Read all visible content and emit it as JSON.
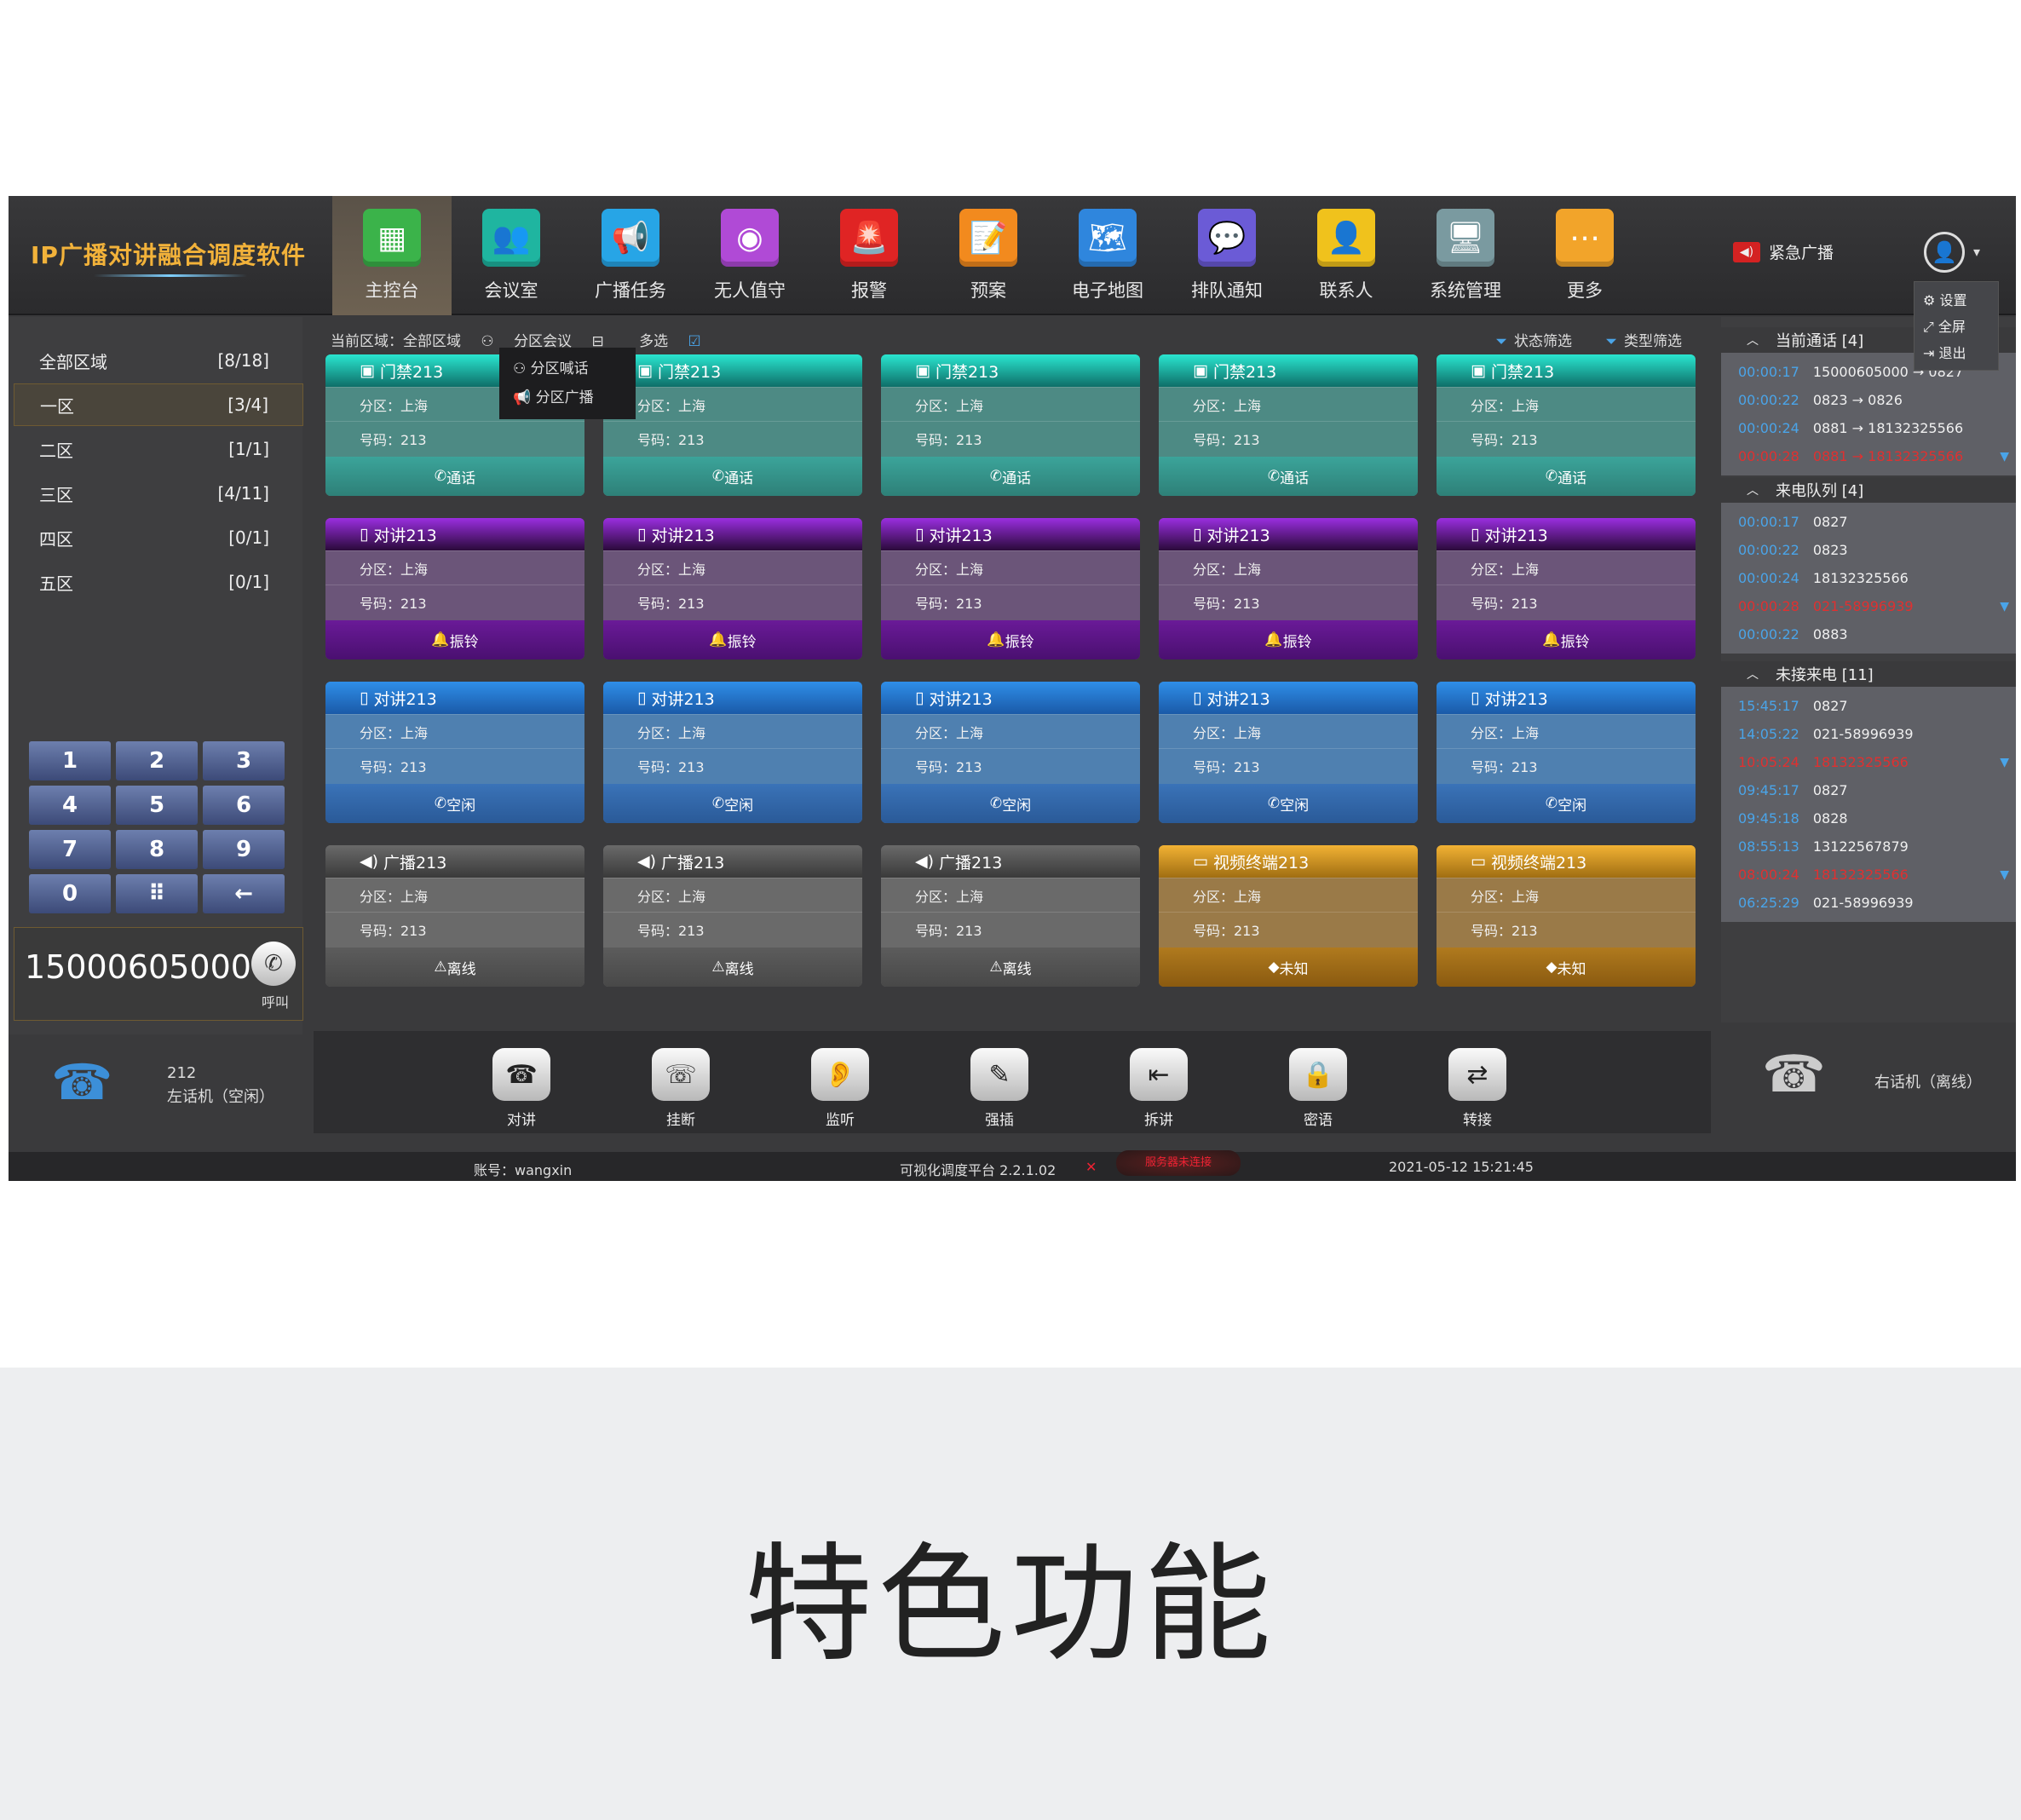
{
  "app": {
    "logo": "IP广播对讲融合调度软件",
    "emergency": "紧急广播",
    "user_menu": [
      "设置",
      "全屏",
      "退出"
    ]
  },
  "nav": [
    {
      "label": "主控台",
      "icon": "dashboard-icon",
      "color": "#3bb34a",
      "glyph": "▦",
      "active": true
    },
    {
      "label": "会议室",
      "icon": "meeting-icon",
      "color": "#1fb5a0",
      "glyph": "👥"
    },
    {
      "label": "广播任务",
      "icon": "broadcast-icon",
      "color": "#27a5e6",
      "glyph": "📢"
    },
    {
      "label": "无人值守",
      "icon": "unattended-icon",
      "color": "#b04ad6",
      "glyph": "◉"
    },
    {
      "label": "报警",
      "icon": "alarm-icon",
      "color": "#e02424",
      "glyph": "🚨"
    },
    {
      "label": "预案",
      "icon": "plan-icon",
      "color": "#f28a1e",
      "glyph": "📝"
    },
    {
      "label": "电子地图",
      "icon": "map-icon",
      "color": "#2f86dd",
      "glyph": "🗺"
    },
    {
      "label": "排队通知",
      "icon": "queue-icon",
      "color": "#6b5bd6",
      "glyph": "💬"
    },
    {
      "label": "联系人",
      "icon": "contacts-icon",
      "color": "#f0c21c",
      "glyph": "👤"
    },
    {
      "label": "系统管理",
      "icon": "system-icon",
      "color": "#7a9aa0",
      "glyph": "🖥"
    },
    {
      "label": "更多",
      "icon": "more-icon",
      "color": "#f2a42a",
      "glyph": "⋯"
    }
  ],
  "zones": [
    {
      "name": "全部区域",
      "count": "[8/18]"
    },
    {
      "name": "一区",
      "count": "[3/4]",
      "selected": true
    },
    {
      "name": "二区",
      "count": "[1/1]"
    },
    {
      "name": "三区",
      "count": "[4/11]"
    },
    {
      "name": "四区",
      "count": "[0/1]"
    },
    {
      "name": "五区",
      "count": "[0/1]"
    }
  ],
  "keypad": [
    "1",
    "2",
    "3",
    "4",
    "5",
    "6",
    "7",
    "8",
    "9",
    "0",
    "⠿",
    "←"
  ],
  "dial": {
    "number": "15000605000",
    "call_label": "呼叫"
  },
  "left_phone": {
    "ext": "212",
    "status": "左话机（空闲）"
  },
  "right_phone": {
    "status": "右话机（离线）"
  },
  "toolbar": {
    "current_zone": "当前区域：全部区域",
    "zone_meeting": "分区会议",
    "multi_select": "多选",
    "state_filter": "状态筛选",
    "type_filter": "类型筛选",
    "dropdown": [
      "分区喊话",
      "分区广播"
    ]
  },
  "cards": [
    [
      {
        "type": "teal",
        "title": "门禁213",
        "zone": "分区：上海",
        "num": "号码：213",
        "action": "通话"
      },
      {
        "type": "teal",
        "title": "门禁213",
        "zone": "分区：上海",
        "num": "号码：213",
        "action": "通话"
      },
      {
        "type": "teal",
        "title": "门禁213",
        "zone": "分区：上海",
        "num": "号码：213",
        "action": "通话"
      },
      {
        "type": "teal",
        "title": "门禁213",
        "zone": "分区：上海",
        "num": "号码：213",
        "action": "通话"
      },
      {
        "type": "teal",
        "title": "门禁213",
        "zone": "分区：上海",
        "num": "号码：213",
        "action": "通话"
      }
    ],
    [
      {
        "type": "purple",
        "title": "对讲213",
        "zone": "分区：上海",
        "num": "号码：213",
        "action": "振铃"
      },
      {
        "type": "purple",
        "title": "对讲213",
        "zone": "分区：上海",
        "num": "号码：213",
        "action": "振铃"
      },
      {
        "type": "purple",
        "title": "对讲213",
        "zone": "分区：上海",
        "num": "号码：213",
        "action": "振铃"
      },
      {
        "type": "purple",
        "title": "对讲213",
        "zone": "分区：上海",
        "num": "号码：213",
        "action": "振铃"
      },
      {
        "type": "purple",
        "title": "对讲213",
        "zone": "分区：上海",
        "num": "号码：213",
        "action": "振铃"
      }
    ],
    [
      {
        "type": "blue",
        "title": "对讲213",
        "zone": "分区：上海",
        "num": "号码：213",
        "action": "空闲"
      },
      {
        "type": "blue",
        "title": "对讲213",
        "zone": "分区：上海",
        "num": "号码：213",
        "action": "空闲"
      },
      {
        "type": "blue",
        "title": "对讲213",
        "zone": "分区：上海",
        "num": "号码：213",
        "action": "空闲"
      },
      {
        "type": "blue",
        "title": "对讲213",
        "zone": "分区：上海",
        "num": "号码：213",
        "action": "空闲"
      },
      {
        "type": "blue",
        "title": "对讲213",
        "zone": "分区：上海",
        "num": "号码：213",
        "action": "空闲"
      }
    ],
    [
      {
        "type": "gray",
        "title": "广播213",
        "zone": "分区：上海",
        "num": "号码：213",
        "action": "离线"
      },
      {
        "type": "gray",
        "title": "广播213",
        "zone": "分区：上海",
        "num": "号码：213",
        "action": "离线"
      },
      {
        "type": "gray",
        "title": "广播213",
        "zone": "分区：上海",
        "num": "号码：213",
        "action": "离线"
      },
      {
        "type": "gold",
        "title": "视频终端213",
        "zone": "分区：上海",
        "num": "号码：213",
        "action": "未知"
      },
      {
        "type": "gold",
        "title": "视频终端213",
        "zone": "分区：上海",
        "num": "号码：213",
        "action": "未知"
      }
    ]
  ],
  "actions": [
    {
      "label": "对讲",
      "icon": "intercom-icon",
      "glyph": "☎"
    },
    {
      "label": "挂断",
      "icon": "hangup-icon",
      "glyph": "☏"
    },
    {
      "label": "监听",
      "icon": "listen-icon",
      "glyph": "👂"
    },
    {
      "label": "强插",
      "icon": "barge-icon",
      "glyph": "✎"
    },
    {
      "label": "拆讲",
      "icon": "split-icon",
      "glyph": "⇤"
    },
    {
      "label": "密语",
      "icon": "whisper-icon",
      "glyph": "🔒"
    },
    {
      "label": "转接",
      "icon": "transfer-icon",
      "glyph": "⇄"
    }
  ],
  "status": {
    "account": "账号：wangxin",
    "platform": "可视化调度平台  2.2.1.02",
    "connection": "服务器未连接",
    "datetime": "2021-05-12   15:21:45"
  },
  "right": {
    "current_calls": {
      "title": "当前通话 [4]",
      "rows": [
        {
          "time": "00:00:17",
          "text": "15000605000 → 0827"
        },
        {
          "time": "00:00:22",
          "text": "0823 → 0826"
        },
        {
          "time": "00:00:24",
          "text": "0881 → 18132325566"
        },
        {
          "time": "00:00:28",
          "text": "0881 → 18132325566",
          "red": true
        }
      ]
    },
    "incoming_queue": {
      "title": "来电队列 [4]",
      "rows": [
        {
          "time": "00:00:17",
          "text": "0827"
        },
        {
          "time": "00:00:22",
          "text": "0823"
        },
        {
          "time": "00:00:24",
          "text": "18132325566"
        },
        {
          "time": "00:00:28",
          "text": "021-58996939",
          "red": true
        },
        {
          "time": "00:00:22",
          "text": "0883"
        }
      ]
    },
    "missed_calls": {
      "title": "未接来电 [11]",
      "rows": [
        {
          "time": "15:45:17",
          "text": "0827"
        },
        {
          "time": "14:05:22",
          "text": "021-58996939"
        },
        {
          "time": "10:05:24",
          "text": "18132325566",
          "red": true
        },
        {
          "time": "09:45:17",
          "text": "0827"
        },
        {
          "time": "09:45:18",
          "text": "0828"
        },
        {
          "time": "08:55:13",
          "text": "13122567879"
        },
        {
          "time": "08:00:24",
          "text": "18132325566",
          "red": true
        },
        {
          "time": "06:25:29",
          "text": "021-58996939"
        }
      ]
    }
  },
  "caption": "特色功能"
}
